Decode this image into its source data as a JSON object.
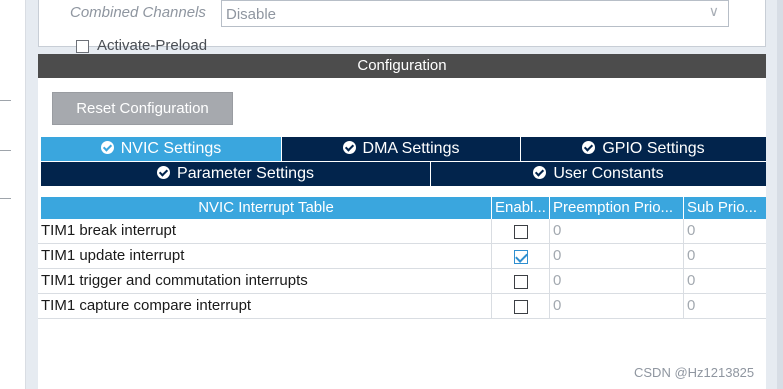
{
  "mode": {
    "combined_channels_label": "Combined Channels",
    "combined_channels_value": "Disable",
    "activate_preload_label": "Activate-Preload"
  },
  "config": {
    "header": "Configuration",
    "reset_button": "Reset Configuration",
    "tabs_row1": [
      "NVIC Settings",
      "DMA Settings",
      "GPIO Settings"
    ],
    "tabs_row2": [
      "Parameter Settings",
      "User Constants"
    ],
    "active_tab": "NVIC Settings"
  },
  "nvic_table": {
    "columns": [
      "NVIC Interrupt Table",
      "Enabl...",
      "Preemption Prio...",
      "Sub Prio..."
    ],
    "rows": [
      {
        "name": "TIM1 break interrupt",
        "enabled": false,
        "preemption": "0",
        "sub": "0"
      },
      {
        "name": "TIM1 update interrupt",
        "enabled": true,
        "preemption": "0",
        "sub": "0"
      },
      {
        "name": "TIM1 trigger and commutation interrupts",
        "enabled": false,
        "preemption": "0",
        "sub": "0"
      },
      {
        "name": "TIM1 capture compare interrupt",
        "enabled": false,
        "preemption": "0",
        "sub": "0"
      }
    ]
  },
  "colors": {
    "active_tab": "#3aa6de",
    "inactive_tab": "#02244c",
    "header_bar": "#4c4c4c",
    "reset_button": "#a6a9ae"
  },
  "icons": {
    "tab_icon": "check-circle-icon",
    "select_icon": "chevron-down-icon"
  },
  "watermark": "CSDN @Hz1213825"
}
